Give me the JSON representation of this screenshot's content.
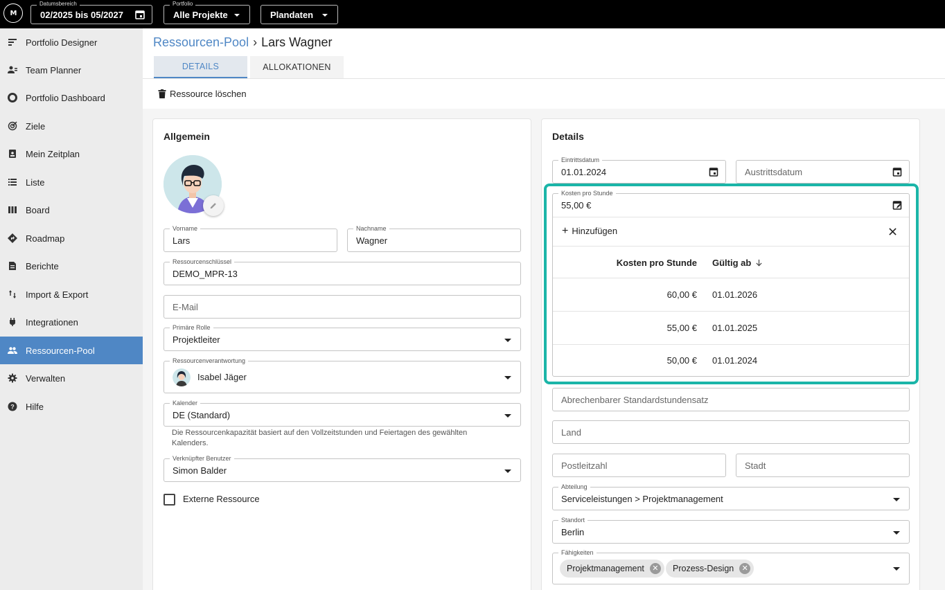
{
  "topbar": {
    "logo_text": "M",
    "date_range": {
      "label": "Datumsbereich",
      "value": "02/2025 bis 05/2027"
    },
    "portfolio": {
      "label": "Portfolio",
      "value": "Alle Projekte"
    },
    "dataset": {
      "value": "Plandaten"
    }
  },
  "sidebar": {
    "items": [
      {
        "label": "Portfolio Designer",
        "icon": "portfolio-designer-icon"
      },
      {
        "label": "Team Planner",
        "icon": "team-planner-icon"
      },
      {
        "label": "Portfolio Dashboard",
        "icon": "dashboard-icon"
      },
      {
        "label": "Ziele",
        "icon": "target-icon"
      },
      {
        "label": "Mein Zeitplan",
        "icon": "schedule-icon"
      },
      {
        "label": "Liste",
        "icon": "list-icon"
      },
      {
        "label": "Board",
        "icon": "board-icon"
      },
      {
        "label": "Roadmap",
        "icon": "roadmap-icon"
      },
      {
        "label": "Berichte",
        "icon": "report-icon"
      },
      {
        "label": "Import & Export",
        "icon": "import-export-icon"
      },
      {
        "label": "Integrationen",
        "icon": "plug-icon"
      },
      {
        "label": "Ressourcen-Pool",
        "icon": "people-icon"
      },
      {
        "label": "Verwalten",
        "icon": "gear-icon"
      },
      {
        "label": "Hilfe",
        "icon": "help-icon"
      }
    ]
  },
  "header": {
    "breadcrumb_parent": "Ressourcen-Pool",
    "breadcrumb_current": "Lars Wagner",
    "tabs": [
      {
        "label": "DETAILS"
      },
      {
        "label": "ALLOKATIONEN"
      }
    ],
    "delete_label": "Ressource löschen"
  },
  "general": {
    "title": "Allgemein",
    "first_name": {
      "label": "Vorname",
      "value": "Lars"
    },
    "last_name": {
      "label": "Nachname",
      "value": "Wagner"
    },
    "resource_key": {
      "label": "Ressourcenschlüssel",
      "value": "DEMO_MPR-13"
    },
    "email": {
      "placeholder": "E-Mail"
    },
    "primary_role": {
      "label": "Primäre Rolle",
      "value": "Projektleiter"
    },
    "responsible": {
      "label": "Ressourcenverantwortung",
      "value": "Isabel Jäger"
    },
    "calendar": {
      "label": "Kalender",
      "value": "DE (Standard)",
      "helper_line1": "Die Ressourcenkapazität basiert auf den Vollzeitstunden und Feiertagen des gewählten",
      "helper_line2": "Kalenders."
    },
    "linked_user": {
      "label": "Verknüpfter Benutzer",
      "value": "Simon Balder"
    },
    "external": {
      "label": "Externe Ressource"
    }
  },
  "details": {
    "title": "Details",
    "entry_date": {
      "label": "Eintrittsdatum",
      "value": "01.01.2024"
    },
    "exit_date": {
      "placeholder": "Austrittsdatum"
    },
    "cost": {
      "label": "Kosten pro Stunde",
      "value": "55,00 €",
      "add_label": "Hinzufügen",
      "col_cost": "Kosten pro Stunde",
      "col_valid": "Gültig ab",
      "rows": [
        {
          "cost": "60,00 €",
          "valid": "01.01.2026"
        },
        {
          "cost": "55,00 €",
          "valid": "01.01.2025"
        },
        {
          "cost": "50,00 €",
          "valid": "01.01.2024"
        }
      ]
    },
    "billable_rate": {
      "placeholder": "Abrechenbarer Standardstundensatz"
    },
    "country": {
      "placeholder": "Land"
    },
    "zip": {
      "placeholder": "Postleitzahl"
    },
    "city": {
      "placeholder": "Stadt"
    },
    "department": {
      "label": "Abteilung",
      "value": "Serviceleistungen > Projektmanagement"
    },
    "location": {
      "label": "Standort",
      "value": "Berlin"
    },
    "skills": {
      "label": "Fähigkeiten",
      "chips": [
        "Projektmanagement",
        "Prozess-Design"
      ]
    }
  },
  "colors": {
    "accent": "#4f87c5",
    "highlight": "#1bb5a8",
    "topbar": "#000000",
    "sidebar": "#ececec"
  }
}
